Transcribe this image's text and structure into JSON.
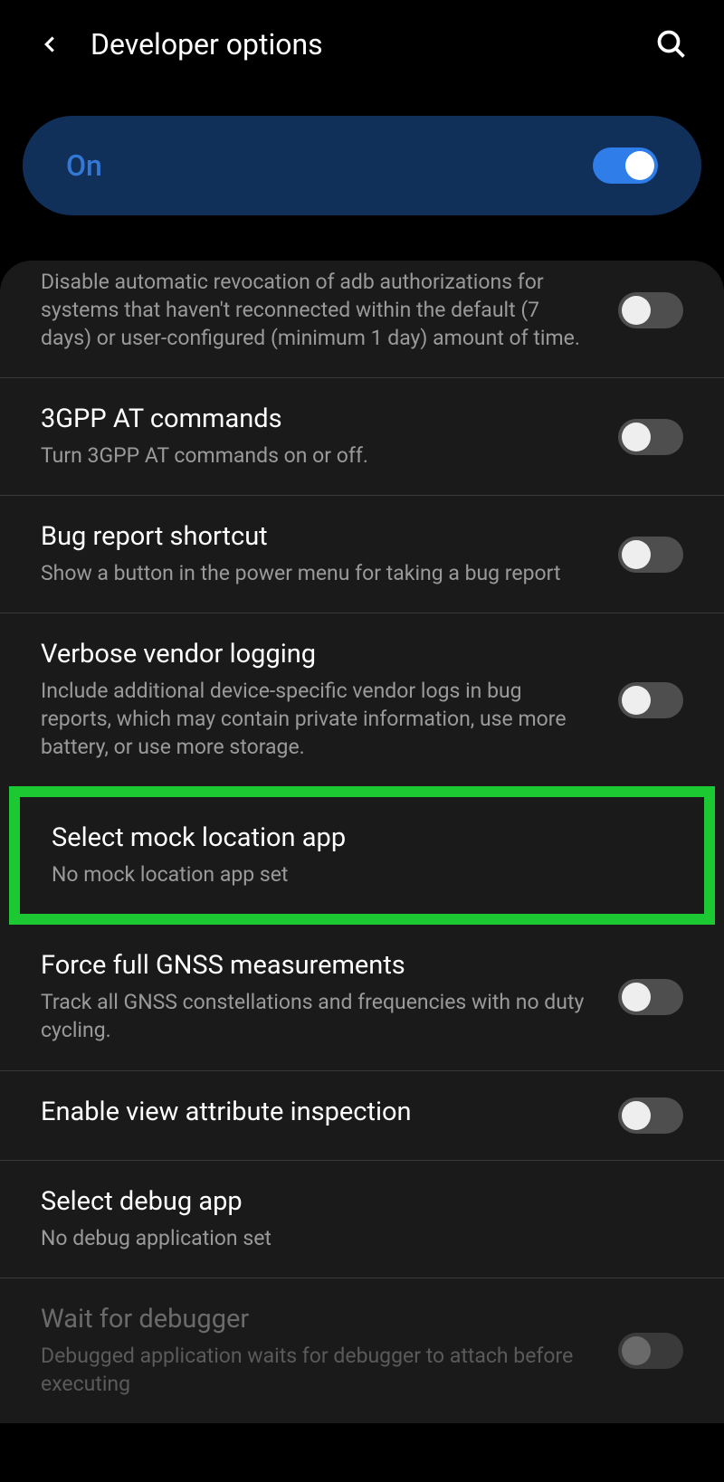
{
  "header": {
    "title": "Developer options"
  },
  "mainToggle": {
    "label": "On",
    "on": true
  },
  "settings": [
    {
      "id": "adb-revocation",
      "title": "",
      "subtitle": "Disable automatic revocation of adb authorizations for systems that haven't reconnected within the default (7 days) or user-configured (minimum 1 day) amount of time.",
      "toggle": true,
      "on": false,
      "first": true
    },
    {
      "id": "3gpp-at",
      "title": "3GPP AT commands",
      "subtitle": "Turn 3GPP AT commands on or off.",
      "toggle": true,
      "on": false
    },
    {
      "id": "bug-report-shortcut",
      "title": "Bug report shortcut",
      "subtitle": "Show a button in the power menu for taking a bug report",
      "toggle": true,
      "on": false
    },
    {
      "id": "verbose-vendor",
      "title": "Verbose vendor logging",
      "subtitle": "Include additional device-specific vendor logs in bug reports, which may contain private information, use more battery, or use more storage.",
      "toggle": true,
      "on": false
    },
    {
      "id": "mock-location",
      "title": "Select mock location app",
      "subtitle": "No mock location app set",
      "toggle": false,
      "highlighted": true
    },
    {
      "id": "force-gnss",
      "title": "Force full GNSS measurements",
      "subtitle": "Track all GNSS constellations and frequencies with no duty cycling.",
      "toggle": true,
      "on": false
    },
    {
      "id": "view-attribute",
      "title": "Enable view attribute inspection",
      "subtitle": "",
      "toggle": true,
      "on": false
    },
    {
      "id": "select-debug",
      "title": "Select debug app",
      "subtitle": "No debug application set",
      "toggle": false
    },
    {
      "id": "wait-debugger",
      "title": "Wait for debugger",
      "subtitle": "Debugged application waits for debugger to attach before executing",
      "toggle": true,
      "on": false,
      "disabled": true,
      "noBorder": true
    }
  ]
}
